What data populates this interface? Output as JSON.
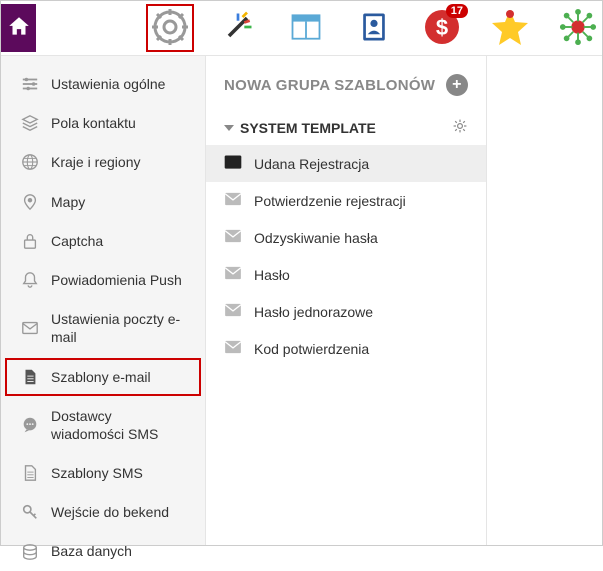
{
  "topbar": {
    "badge_count": "17"
  },
  "sidebar": {
    "items": [
      {
        "label": "Ustawienia ogólne"
      },
      {
        "label": "Pola kontaktu"
      },
      {
        "label": "Kraje i regiony"
      },
      {
        "label": "Mapy"
      },
      {
        "label": "Captcha"
      },
      {
        "label": "Powiadomienia Push"
      },
      {
        "label": "Ustawienia poczty e-mail"
      },
      {
        "label": "Szablony e-mail"
      },
      {
        "label": "Dostawcy wiadomości SMS"
      },
      {
        "label": "Szablony SMS"
      },
      {
        "label": "Wejście do bekend"
      },
      {
        "label": "Baza danych"
      }
    ]
  },
  "main": {
    "group_title": "NOWA GRUPA SZABLONÓW",
    "section_title": "SYSTEM TEMPLATE",
    "templates": [
      {
        "label": "Udana Rejestracja",
        "active": true
      },
      {
        "label": "Potwierdzenie rejestracji",
        "active": false
      },
      {
        "label": "Odzyskiwanie hasła",
        "active": false
      },
      {
        "label": "Hasło",
        "active": false
      },
      {
        "label": "Hasło jednorazowe",
        "active": false
      },
      {
        "label": "Kod potwierdzenia",
        "active": false
      }
    ]
  }
}
